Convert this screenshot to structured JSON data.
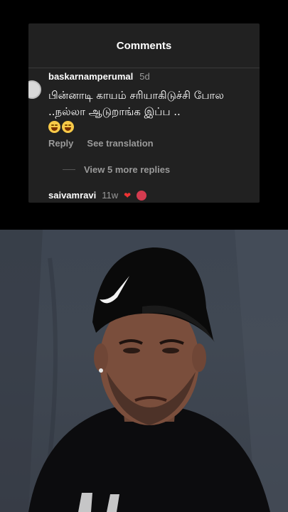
{
  "comments_panel": {
    "title": "Comments",
    "comment": {
      "username": "baskarnamperumal",
      "age": "5d",
      "text": "பின்னாடி காயம் சரியாகிடுச்சி போல ..நல்லா ஆடுறாங்க இப்ப ..",
      "emojis": [
        "face-with-tears-of-joy",
        "face-with-tears-of-joy"
      ],
      "reply_label": "Reply",
      "translation_label": "See translation"
    },
    "view_replies_label": "View 5 more replies",
    "next_comment": {
      "username": "saivamravi",
      "age": "11w"
    }
  },
  "colors": {
    "panel_bg": "#212121",
    "muted_text": "#9a9a9a",
    "page_bg": "#000000"
  }
}
